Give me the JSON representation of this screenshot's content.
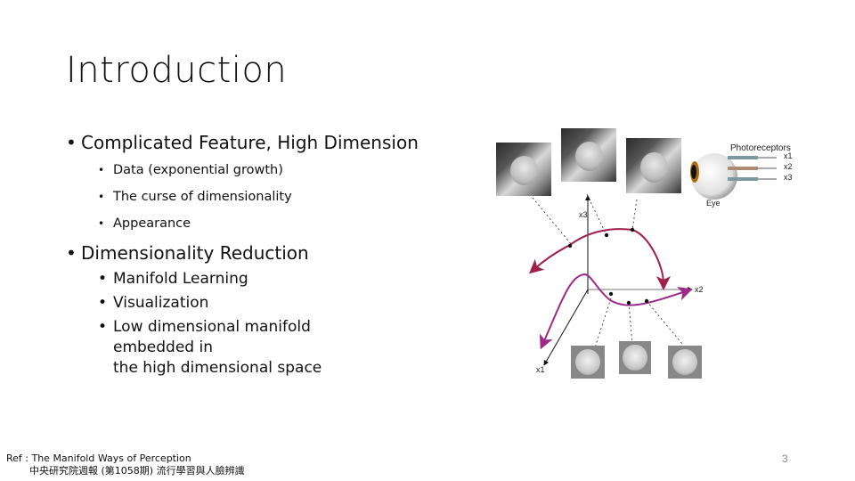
{
  "slide": {
    "title": "Introduction",
    "bullets": [
      {
        "text": "Complicated Feature, High Dimension",
        "children": [
          "Data (exponential growth)",
          "The curse of dimensionality",
          "Appearance"
        ]
      },
      {
        "text": "Dimensionality Reduction",
        "children": [
          "Manifold Learning",
          "Visualization",
          "Low dimensional manifold",
          "embedded in",
          "the high dimensional space"
        ]
      }
    ],
    "bullet_glyph": "•",
    "reference": {
      "line1": "Ref : The Manifold Ways of Perception",
      "line2": "中央研究院週報 (第1058期) 流行學習與人臉辨識"
    },
    "page_number": "3"
  },
  "figure": {
    "photoreceptors_label": "Photoreceptors",
    "eye_label": "Eye",
    "receptor_labels": [
      "x1",
      "x2",
      "x3"
    ],
    "axis_labels": {
      "x1": "x1",
      "x2": "x2",
      "x3": "x3"
    },
    "colors": {
      "curve_top": "#a0204a",
      "curve_bottom": "#9b2a8c",
      "iris": "#b06a10"
    }
  }
}
